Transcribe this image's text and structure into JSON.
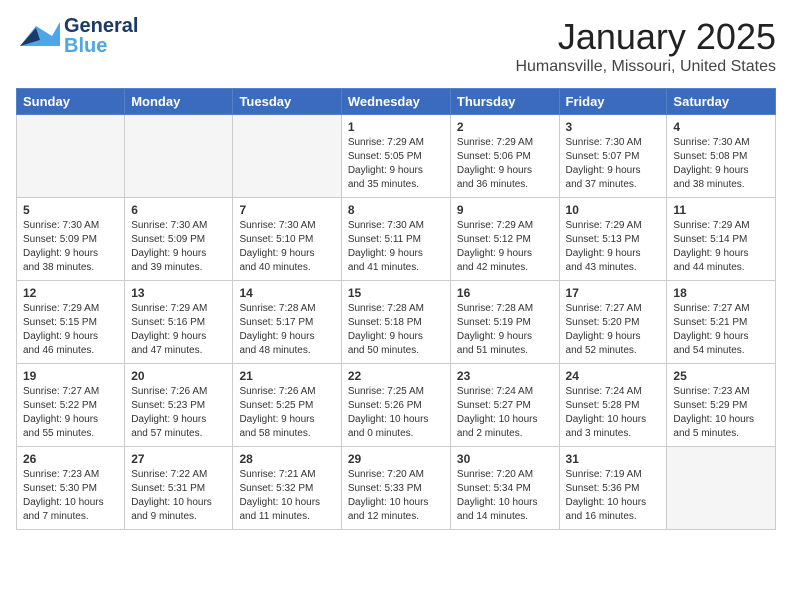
{
  "logo": {
    "general": "General",
    "blue": "Blue"
  },
  "title": "January 2025",
  "subtitle": "Humansville, Missouri, United States",
  "weekdays": [
    "Sunday",
    "Monday",
    "Tuesday",
    "Wednesday",
    "Thursday",
    "Friday",
    "Saturday"
  ],
  "weeks": [
    [
      {
        "day": "",
        "detail": ""
      },
      {
        "day": "",
        "detail": ""
      },
      {
        "day": "",
        "detail": ""
      },
      {
        "day": "1",
        "detail": "Sunrise: 7:29 AM\nSunset: 5:05 PM\nDaylight: 9 hours\nand 35 minutes."
      },
      {
        "day": "2",
        "detail": "Sunrise: 7:29 AM\nSunset: 5:06 PM\nDaylight: 9 hours\nand 36 minutes."
      },
      {
        "day": "3",
        "detail": "Sunrise: 7:30 AM\nSunset: 5:07 PM\nDaylight: 9 hours\nand 37 minutes."
      },
      {
        "day": "4",
        "detail": "Sunrise: 7:30 AM\nSunset: 5:08 PM\nDaylight: 9 hours\nand 38 minutes."
      }
    ],
    [
      {
        "day": "5",
        "detail": "Sunrise: 7:30 AM\nSunset: 5:09 PM\nDaylight: 9 hours\nand 38 minutes."
      },
      {
        "day": "6",
        "detail": "Sunrise: 7:30 AM\nSunset: 5:09 PM\nDaylight: 9 hours\nand 39 minutes."
      },
      {
        "day": "7",
        "detail": "Sunrise: 7:30 AM\nSunset: 5:10 PM\nDaylight: 9 hours\nand 40 minutes."
      },
      {
        "day": "8",
        "detail": "Sunrise: 7:30 AM\nSunset: 5:11 PM\nDaylight: 9 hours\nand 41 minutes."
      },
      {
        "day": "9",
        "detail": "Sunrise: 7:29 AM\nSunset: 5:12 PM\nDaylight: 9 hours\nand 42 minutes."
      },
      {
        "day": "10",
        "detail": "Sunrise: 7:29 AM\nSunset: 5:13 PM\nDaylight: 9 hours\nand 43 minutes."
      },
      {
        "day": "11",
        "detail": "Sunrise: 7:29 AM\nSunset: 5:14 PM\nDaylight: 9 hours\nand 44 minutes."
      }
    ],
    [
      {
        "day": "12",
        "detail": "Sunrise: 7:29 AM\nSunset: 5:15 PM\nDaylight: 9 hours\nand 46 minutes."
      },
      {
        "day": "13",
        "detail": "Sunrise: 7:29 AM\nSunset: 5:16 PM\nDaylight: 9 hours\nand 47 minutes."
      },
      {
        "day": "14",
        "detail": "Sunrise: 7:28 AM\nSunset: 5:17 PM\nDaylight: 9 hours\nand 48 minutes."
      },
      {
        "day": "15",
        "detail": "Sunrise: 7:28 AM\nSunset: 5:18 PM\nDaylight: 9 hours\nand 50 minutes."
      },
      {
        "day": "16",
        "detail": "Sunrise: 7:28 AM\nSunset: 5:19 PM\nDaylight: 9 hours\nand 51 minutes."
      },
      {
        "day": "17",
        "detail": "Sunrise: 7:27 AM\nSunset: 5:20 PM\nDaylight: 9 hours\nand 52 minutes."
      },
      {
        "day": "18",
        "detail": "Sunrise: 7:27 AM\nSunset: 5:21 PM\nDaylight: 9 hours\nand 54 minutes."
      }
    ],
    [
      {
        "day": "19",
        "detail": "Sunrise: 7:27 AM\nSunset: 5:22 PM\nDaylight: 9 hours\nand 55 minutes."
      },
      {
        "day": "20",
        "detail": "Sunrise: 7:26 AM\nSunset: 5:23 PM\nDaylight: 9 hours\nand 57 minutes."
      },
      {
        "day": "21",
        "detail": "Sunrise: 7:26 AM\nSunset: 5:25 PM\nDaylight: 9 hours\nand 58 minutes."
      },
      {
        "day": "22",
        "detail": "Sunrise: 7:25 AM\nSunset: 5:26 PM\nDaylight: 10 hours\nand 0 minutes."
      },
      {
        "day": "23",
        "detail": "Sunrise: 7:24 AM\nSunset: 5:27 PM\nDaylight: 10 hours\nand 2 minutes."
      },
      {
        "day": "24",
        "detail": "Sunrise: 7:24 AM\nSunset: 5:28 PM\nDaylight: 10 hours\nand 3 minutes."
      },
      {
        "day": "25",
        "detail": "Sunrise: 7:23 AM\nSunset: 5:29 PM\nDaylight: 10 hours\nand 5 minutes."
      }
    ],
    [
      {
        "day": "26",
        "detail": "Sunrise: 7:23 AM\nSunset: 5:30 PM\nDaylight: 10 hours\nand 7 minutes."
      },
      {
        "day": "27",
        "detail": "Sunrise: 7:22 AM\nSunset: 5:31 PM\nDaylight: 10 hours\nand 9 minutes."
      },
      {
        "day": "28",
        "detail": "Sunrise: 7:21 AM\nSunset: 5:32 PM\nDaylight: 10 hours\nand 11 minutes."
      },
      {
        "day": "29",
        "detail": "Sunrise: 7:20 AM\nSunset: 5:33 PM\nDaylight: 10 hours\nand 12 minutes."
      },
      {
        "day": "30",
        "detail": "Sunrise: 7:20 AM\nSunset: 5:34 PM\nDaylight: 10 hours\nand 14 minutes."
      },
      {
        "day": "31",
        "detail": "Sunrise: 7:19 AM\nSunset: 5:36 PM\nDaylight: 10 hours\nand 16 minutes."
      },
      {
        "day": "",
        "detail": ""
      }
    ]
  ]
}
